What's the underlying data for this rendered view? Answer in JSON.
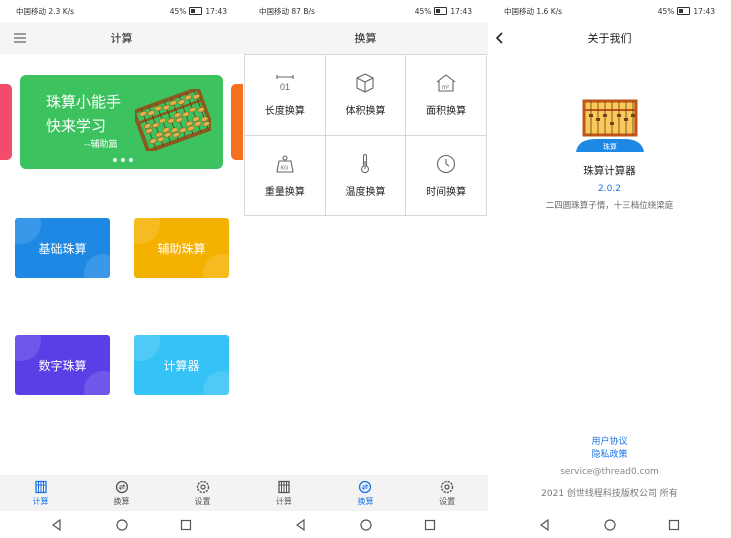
{
  "status_bar": {
    "carrier": "中国移动",
    "net_speeds": [
      "2.3 K/s",
      "87 B/s",
      "1.6 K/s"
    ],
    "battery": "45%",
    "time": "17:43"
  },
  "screen1": {
    "title": "计算",
    "banner": {
      "line1": "珠算小能手",
      "line2": "快来学习",
      "line3": "--辅助篇"
    },
    "tiles": [
      {
        "label": "基础珠算",
        "color": "#1e88e5"
      },
      {
        "label": "辅助珠算",
        "color": "#f5b100"
      },
      {
        "label": "数字珠算",
        "color": "#5b3fe6"
      },
      {
        "label": "计算器",
        "color": "#35c2f5"
      }
    ]
  },
  "screen2": {
    "title": "换算",
    "items": [
      {
        "label": "长度换算",
        "icon": "ruler-icon"
      },
      {
        "label": "体积换算",
        "icon": "cube-icon"
      },
      {
        "label": "面积换算",
        "icon": "house-area-icon"
      },
      {
        "label": "重量换算",
        "icon": "weight-icon"
      },
      {
        "label": "温度换算",
        "icon": "thermometer-icon"
      },
      {
        "label": "时间换算",
        "icon": "clock-icon"
      }
    ]
  },
  "screen3": {
    "title": "关于我们",
    "logo_text": "珠算",
    "app_name": "珠算计算器",
    "version": "2.0.2",
    "slogan": "二四圆珠算子情，十三档位绕梁庭",
    "user_agreement": "用户协议",
    "privacy_policy": "隐私政策",
    "email": "service@thread0.com",
    "copyright": "2021 创世线程科技版权公司 所有"
  },
  "tabbar": {
    "tabs": [
      {
        "label": "计算",
        "icon": "abacus-tab-icon"
      },
      {
        "label": "换算",
        "icon": "convert-tab-icon"
      },
      {
        "label": "设置",
        "icon": "gear-icon"
      }
    ]
  },
  "colors": {
    "accent": "#1a73e8",
    "banner_green": "#3cc35f"
  }
}
